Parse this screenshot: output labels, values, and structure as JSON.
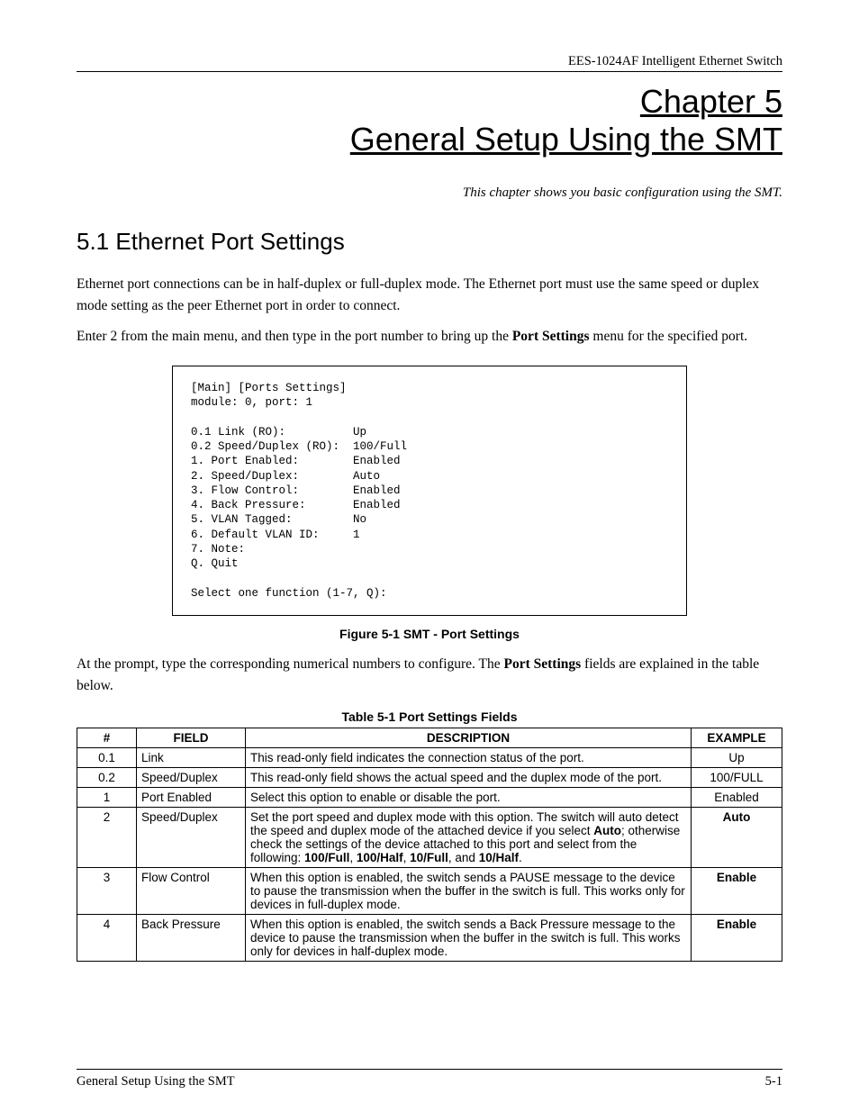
{
  "header": {
    "device": "EES-1024AF Intelligent Ethernet Switch"
  },
  "chapter": {
    "num_line": "Chapter 5",
    "title": "General Setup Using the SMT",
    "desc": "This chapter shows you basic configuration using the SMT."
  },
  "section": {
    "heading": "5.1 Ethernet Port Settings",
    "p1": "Ethernet port connections can be in half-duplex or full-duplex mode. The Ethernet port must use the same speed or duplex mode setting as the peer Ethernet port in order to connect.",
    "p2a": "Enter 2 from the main menu, and then type in the port number to bring up the ",
    "p2b": "Port Settings",
    "p2c": " menu for the specified port."
  },
  "terminal": {
    "l1": "[Main] [Ports Settings]",
    "l2": "module: 0, port: 1",
    "l3": "",
    "l4": "0.1 Link (RO):          Up",
    "l5": "0.2 Speed/Duplex (RO):  100/Full",
    "l6": "1. Port Enabled:        Enabled",
    "l7": "2. Speed/Duplex:        Auto",
    "l8": "3. Flow Control:        Enabled",
    "l9": "4. Back Pressure:       Enabled",
    "l10": "5. VLAN Tagged:         No",
    "l11": "6. Default VLAN ID:     1",
    "l12": "7. Note:",
    "l13": "Q. Quit",
    "l14": "",
    "l15": "Select one function (1-7, Q):"
  },
  "figure_caption": "Figure 5-1 SMT - Port Settings",
  "after_terminal": {
    "a": "At the prompt, type the corresponding numerical numbers to configure. The ",
    "b": "Port Settings",
    "c": " fields are explained in the table below."
  },
  "table": {
    "caption": "Table 5-1 Port Settings Fields",
    "headers": {
      "num": "#",
      "field": "FIELD",
      "desc": "DESCRIPTION",
      "ex": "EXAMPLE"
    },
    "rows": [
      {
        "num": "0.1",
        "field": "Link",
        "desc_plain": "This read-only field indicates the connection status of the port.",
        "ex": "Up",
        "ex_bold": false
      },
      {
        "num": "0.2",
        "field": "Speed/Duplex",
        "desc_plain": "This read-only field shows the actual speed and the duplex mode of the port.",
        "ex": "100/FULL",
        "ex_bold": false
      },
      {
        "num": "1",
        "field": "Port Enabled",
        "desc_plain": "Select this option to enable or disable the port.",
        "ex": "Enabled",
        "ex_bold": false
      },
      {
        "num": "2",
        "field": "Speed/Duplex",
        "desc_rich": {
          "a": "Set the port speed and duplex mode with this option. The switch will auto detect the speed and duplex mode of the attached device if you select ",
          "b": "Auto",
          "c": "; otherwise check the settings of the device attached to this port and select from the following: ",
          "d": "100/Full",
          "e": ", ",
          "f": "100/Half",
          "g": ", ",
          "h": "10/Full",
          "i": ", and ",
          "j": "10/Half",
          "k": "."
        },
        "ex": "Auto",
        "ex_bold": true
      },
      {
        "num": "3",
        "field": "Flow Control",
        "desc_plain": "When this option is enabled, the switch sends a PAUSE message to the device to pause the transmission when the buffer in the switch is full. This works only for devices in full-duplex mode.",
        "ex": "Enable",
        "ex_bold": true
      },
      {
        "num": "4",
        "field": "Back Pressure",
        "desc_plain": "When this option is enabled, the switch sends a Back Pressure message to the device to pause the transmission when the buffer in the switch is full. This works only for devices in half-duplex mode.",
        "ex": "Enable",
        "ex_bold": true
      }
    ]
  },
  "footer": {
    "left": "General Setup Using the SMT",
    "right": "5-1"
  }
}
